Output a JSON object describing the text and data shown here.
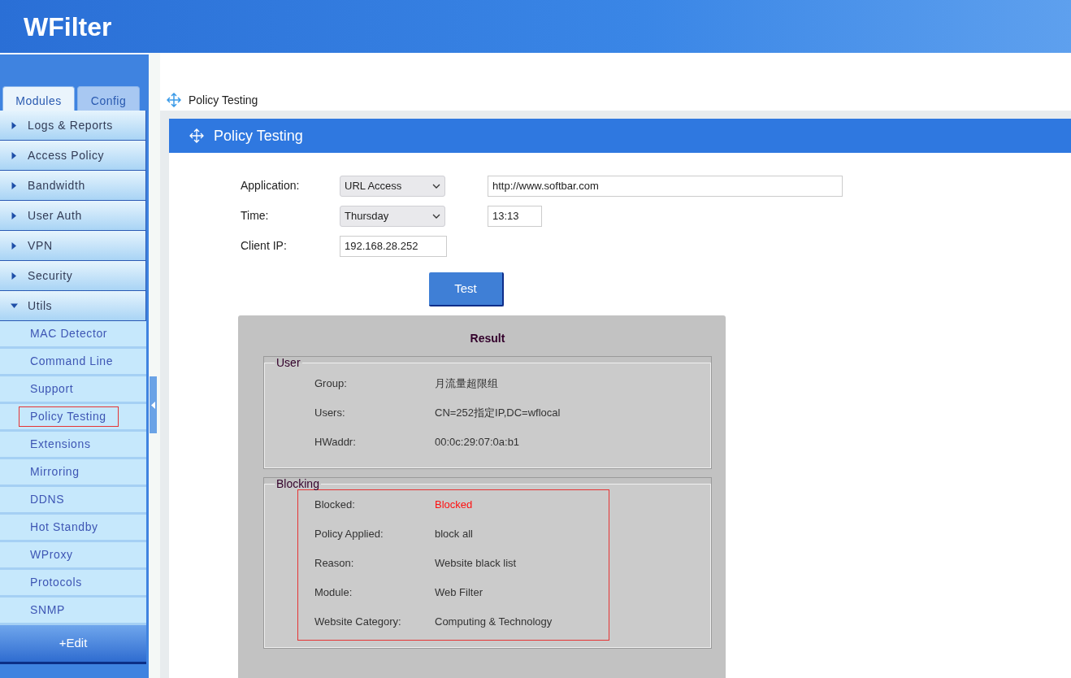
{
  "header": {
    "logo": "WFilter"
  },
  "sidebar": {
    "tabs": [
      {
        "label": "Modules",
        "selected": true
      },
      {
        "label": "Config",
        "selected": false
      }
    ],
    "items": [
      {
        "label": "Logs & Reports",
        "expanded": false
      },
      {
        "label": "Access Policy",
        "expanded": false
      },
      {
        "label": "Bandwidth",
        "expanded": false
      },
      {
        "label": "User Auth",
        "expanded": false
      },
      {
        "label": "VPN",
        "expanded": false
      },
      {
        "label": "Security",
        "expanded": false
      },
      {
        "label": "Utils",
        "expanded": true,
        "children": [
          {
            "label": "MAC Detector",
            "selected": false
          },
          {
            "label": "Command Line",
            "selected": false
          },
          {
            "label": "Support",
            "selected": false
          },
          {
            "label": "Policy Testing",
            "selected": true
          },
          {
            "label": "Extensions",
            "selected": false
          },
          {
            "label": "Mirroring",
            "selected": false
          },
          {
            "label": "DDNS",
            "selected": false
          },
          {
            "label": "Hot Standby",
            "selected": false
          },
          {
            "label": "WProxy",
            "selected": false
          },
          {
            "label": "Protocols",
            "selected": false
          },
          {
            "label": "SNMP",
            "selected": false
          }
        ]
      }
    ],
    "edit_button": "+Edit"
  },
  "breadcrumb": "Policy Testing",
  "panel": {
    "title": "Policy Testing",
    "form": {
      "application_label": "Application:",
      "application": "URL Access",
      "url": "http://www.softbar.com",
      "time_label": "Time:",
      "day": "Thursday",
      "time": "13:13",
      "client_ip_label": "Client IP:",
      "client_ip": "192.168.28.252"
    },
    "test_button": "Test",
    "result": {
      "title": "Result",
      "groups": [
        {
          "legend": "User",
          "highlighted": false,
          "rows": [
            {
              "label": "Group:",
              "value": "月流量超限组",
              "alert": false
            },
            {
              "label": "Users:",
              "value": "CN=252指定IP,DC=wflocal",
              "alert": false
            },
            {
              "label": "HWaddr:",
              "value": "00:0c:29:07:0a:b1",
              "alert": false
            }
          ]
        },
        {
          "legend": "Blocking",
          "highlighted": true,
          "rows": [
            {
              "label": "Blocked:",
              "value": "Blocked",
              "alert": true
            },
            {
              "label": "Policy Applied:",
              "value": "block all",
              "alert": false
            },
            {
              "label": "Reason:",
              "value": "Website black list",
              "alert": false
            },
            {
              "label": "Module:",
              "value": "Web Filter",
              "alert": false
            },
            {
              "label": "Website Category:",
              "value": "Computing & Technology",
              "alert": false
            }
          ]
        }
      ]
    }
  }
}
